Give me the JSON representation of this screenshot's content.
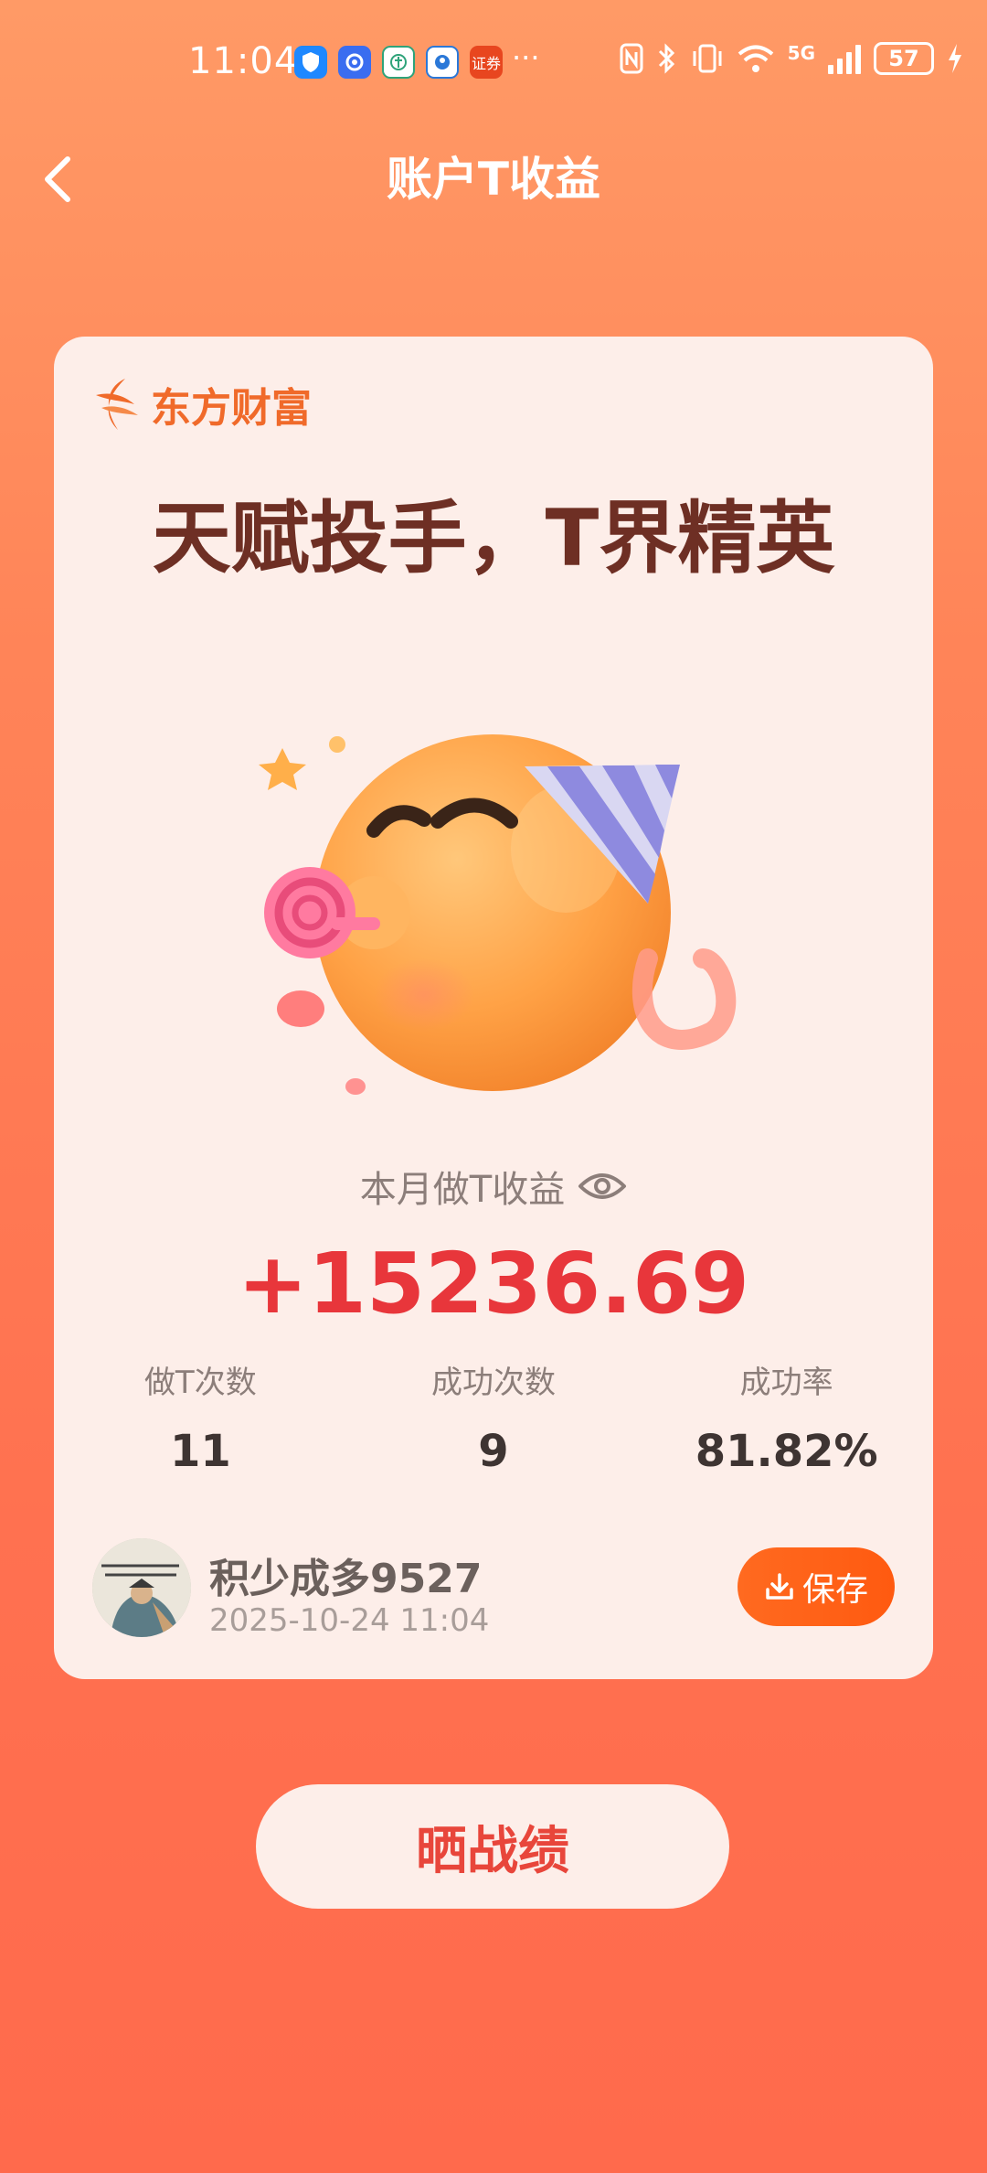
{
  "status_bar": {
    "time": "11:04",
    "apps": [
      {
        "icon": "shield-app-icon",
        "color": "#1e88ff",
        "label": ""
      },
      {
        "icon": "blue-app-icon",
        "color": "#3a6df0",
        "label": ""
      },
      {
        "icon": "green-app-icon",
        "color": "#2ea37a",
        "label": ""
      },
      {
        "icon": "circle-app-icon",
        "color": "#2a78d8",
        "label": ""
      },
      {
        "icon": "securities-app-icon",
        "color": "#e8461f",
        "label": "证券"
      }
    ],
    "overflow": "···",
    "network": "5G",
    "battery": "57"
  },
  "header": {
    "title": "账户T收益"
  },
  "card": {
    "brand": "东方财富",
    "slogan": "天赋投手，T界精英",
    "metric_label": "本月做T收益",
    "metric_value": "+15236.69",
    "stats": [
      {
        "label": "做T次数",
        "value": "11"
      },
      {
        "label": "成功次数",
        "value": "9"
      },
      {
        "label": "成功率",
        "value": "81.82%"
      }
    ],
    "user": {
      "name": "积少成多9527",
      "timestamp": "2025-10-24 11:04"
    },
    "save_label": "保存"
  },
  "share_label": "晒战绩",
  "colors": {
    "accent": "#ff6a20",
    "value_red": "#e8363b",
    "card_bg": "#fdeee9"
  }
}
